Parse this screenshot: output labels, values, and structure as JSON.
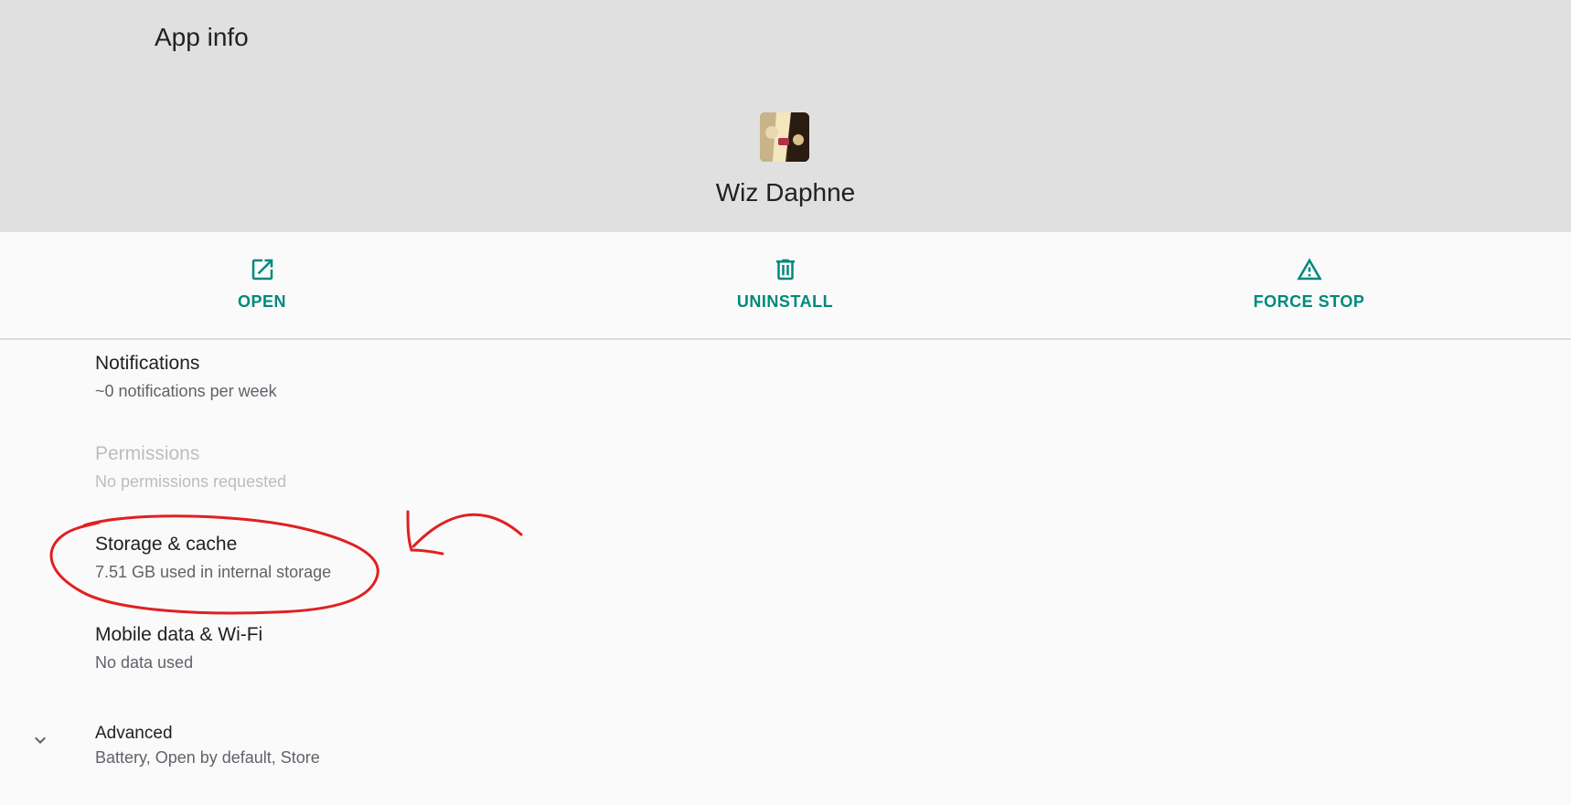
{
  "header": {
    "title": "App info",
    "app_name": "Wiz Daphne"
  },
  "actions": {
    "open": "OPEN",
    "uninstall": "UNINSTALL",
    "force_stop": "FORCE STOP"
  },
  "items": {
    "notifications": {
      "title": "Notifications",
      "subtitle": "~0 notifications per week"
    },
    "permissions": {
      "title": "Permissions",
      "subtitle": "No permissions requested"
    },
    "storage": {
      "title": "Storage & cache",
      "subtitle": "7.51 GB used in internal storage"
    },
    "mobile_data": {
      "title": "Mobile data & Wi-Fi",
      "subtitle": "No data used"
    },
    "advanced": {
      "title": "Advanced",
      "subtitle": "Battery, Open by default, Store"
    }
  },
  "colors": {
    "accent": "#00897b",
    "header_bg": "#e0e0e0",
    "annotation": "#e02020"
  },
  "icons": {
    "open": "open-in-new-icon",
    "uninstall": "trash-icon",
    "force_stop": "warning-icon",
    "advanced": "chevron-down-icon"
  }
}
